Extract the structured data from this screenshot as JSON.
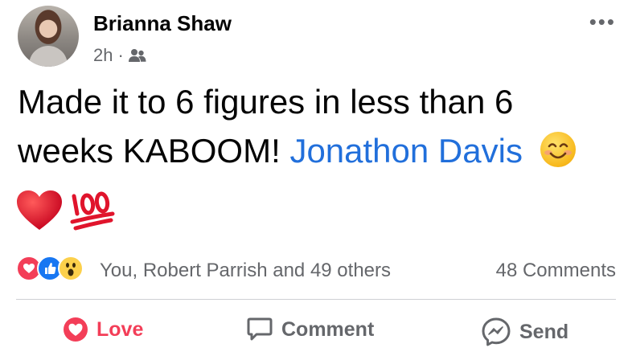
{
  "post": {
    "author": "Brianna Shaw",
    "time": "2h",
    "separator": "·",
    "audience_icon": "friends-icon",
    "more_icon": "•••",
    "text_main": "Made it to 6 figures in less than 6 weeks KABOOM!",
    "mention": "Jonathon Davis",
    "emojis": [
      "smiling-face",
      "red-heart",
      "hundred-points"
    ]
  },
  "reactions": {
    "types": [
      "love",
      "like",
      "wow"
    ],
    "summary": "You, Robert Parrish and 49 others",
    "comments": "48 Comments"
  },
  "actions": {
    "love": "Love",
    "comment": "Comment",
    "send": "Send"
  },
  "colors": {
    "mention": "#216fdb",
    "love": "#f33e58",
    "like": "#1877f2",
    "secondary_text": "#65676b"
  }
}
